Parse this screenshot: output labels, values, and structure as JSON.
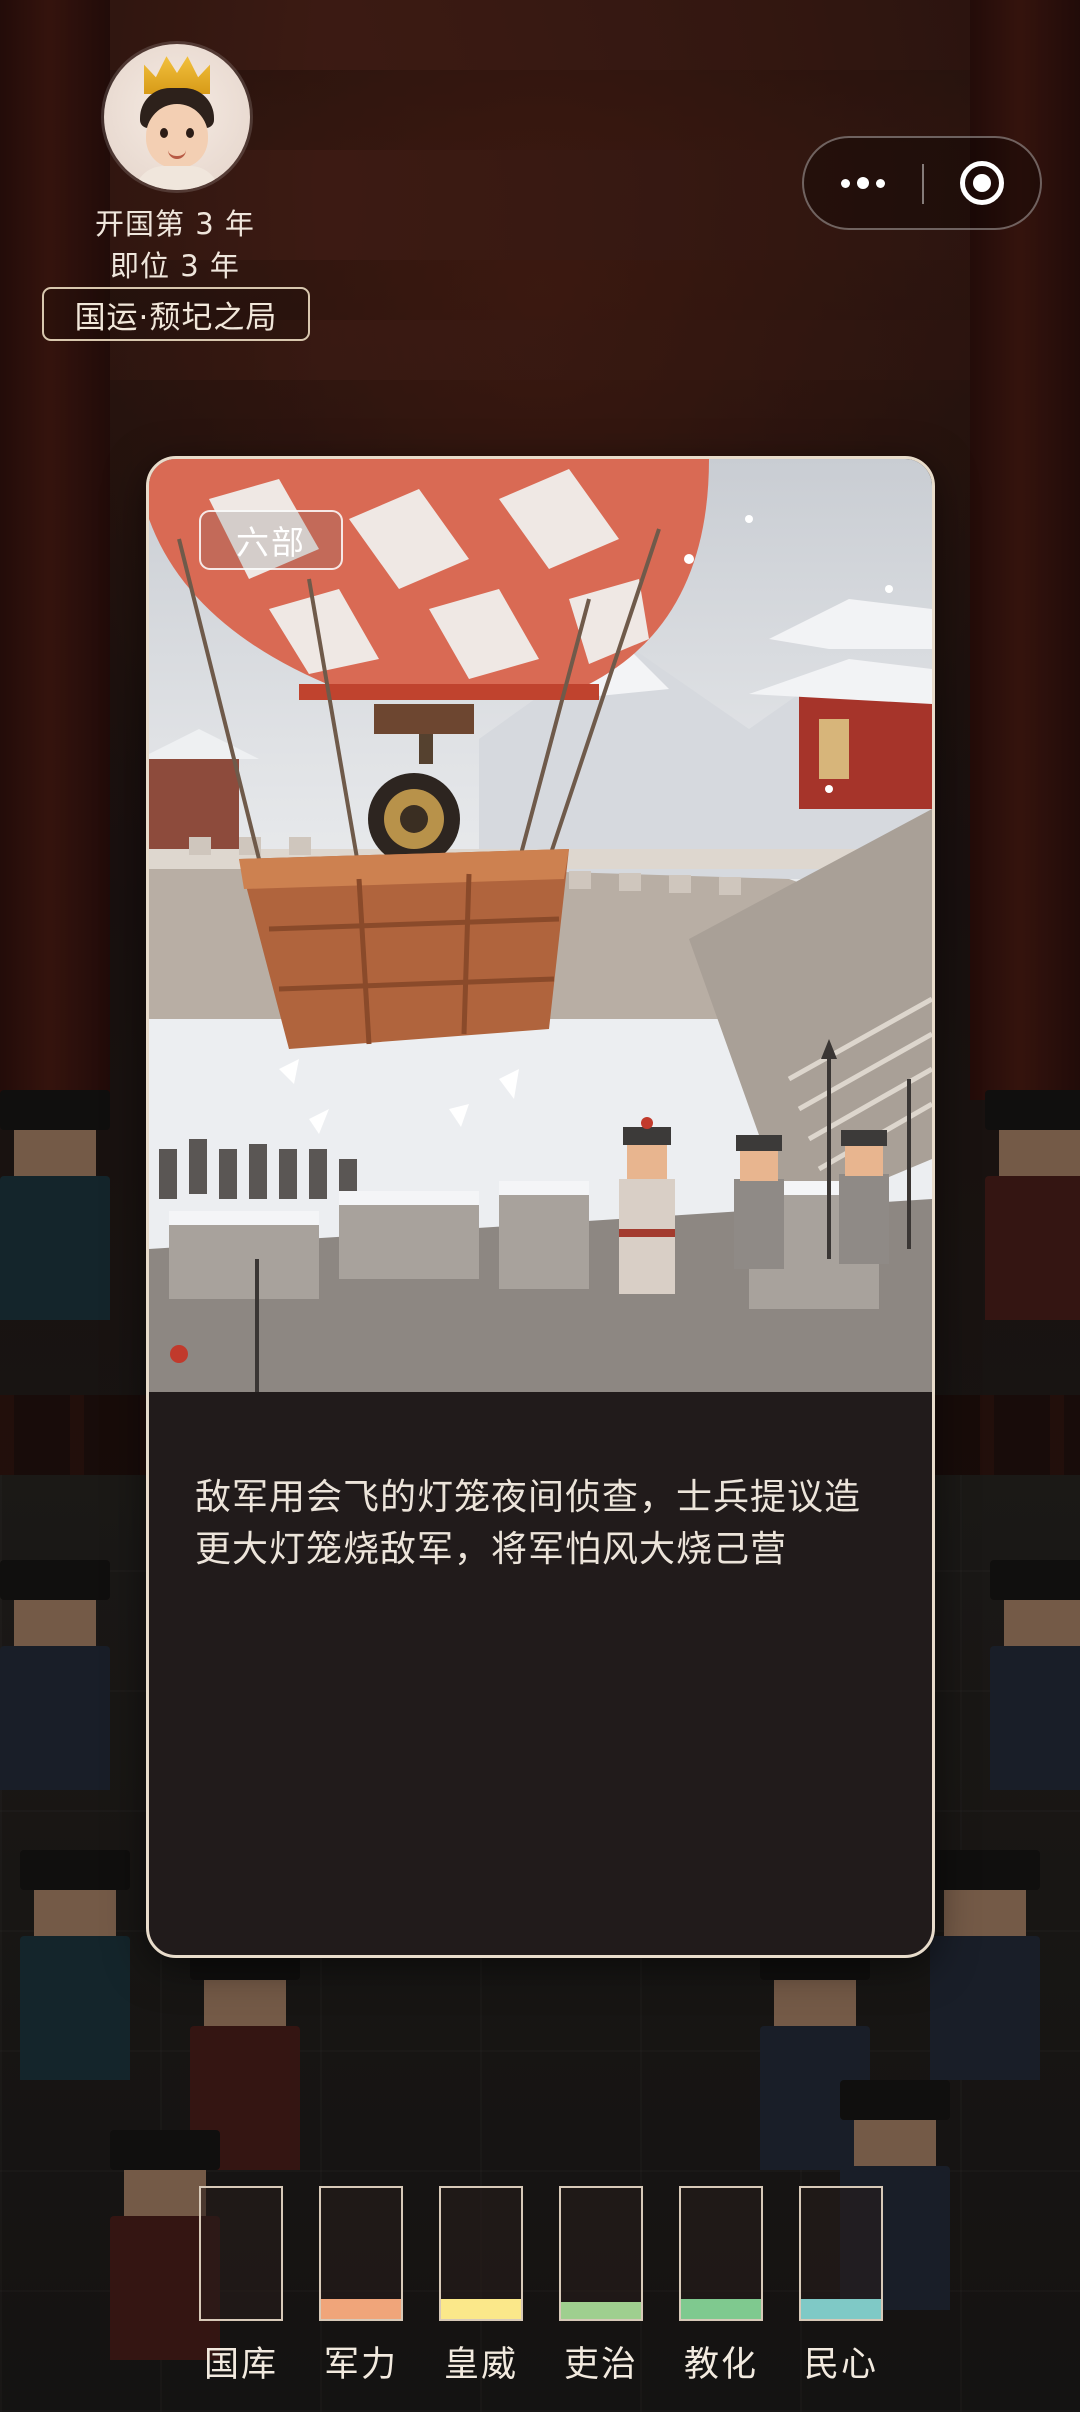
{
  "header": {
    "founding_year": "开国第 3 年",
    "reign_year": "即位 3 年",
    "era": "国运·颓圮之局"
  },
  "capsule": {
    "more_icon": "more-dots-icon",
    "close_icon": "target-close-icon"
  },
  "card": {
    "ministry": "六部",
    "event_text": "敌军用会飞的灯笼夜间侦查，士兵提议造更大灯笼烧敌军，将军怕风大烧己营"
  },
  "stats": [
    {
      "key": "treasury",
      "label": "国库",
      "level": 0.0,
      "color": "#f0a57a"
    },
    {
      "key": "military",
      "label": "军力",
      "level": 0.15,
      "color": "#f0a57a"
    },
    {
      "key": "prestige",
      "label": "皇威",
      "level": 0.15,
      "color": "#fbe88a"
    },
    {
      "key": "governance",
      "label": "吏治",
      "level": 0.13,
      "color": "#9fcf8f"
    },
    {
      "key": "education",
      "label": "教化",
      "level": 0.15,
      "color": "#7fc98f"
    },
    {
      "key": "people",
      "label": "民心",
      "level": 0.15,
      "color": "#7fc9c6"
    }
  ]
}
